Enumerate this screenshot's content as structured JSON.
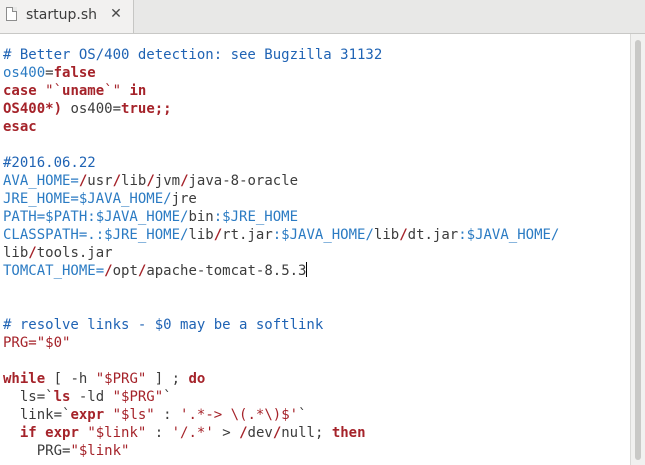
{
  "tab": {
    "filename": "startup.sh",
    "close_glyph": "✕"
  },
  "code": {
    "l1": "# Better OS/400 detection: see Bugzilla 31132",
    "l2": [
      "os400",
      "=",
      "false"
    ],
    "l3": [
      "case",
      " \"`",
      "uname",
      "`\" ",
      "in"
    ],
    "l4": [
      "OS400*)",
      " os400=",
      "true",
      ";;"
    ],
    "l5": "esac",
    "l7": "#2016.06.22",
    "l8": [
      "AVA_HOME=",
      "/",
      "usr",
      "/",
      "lib",
      "/",
      "jvm",
      "/",
      "java-8-oracle"
    ],
    "l9": [
      "JRE_HOME=$JAVA_HOME/",
      "jre"
    ],
    "l10": [
      "PATH=$PATH:$JAVA_HOME/",
      "bin",
      ":$JRE_HOME"
    ],
    "l11": [
      "CLASSPATH=.:$JRE_HOME/",
      "lib",
      "/",
      "rt.jar",
      ":$JAVA_HOME/",
      "lib",
      "/",
      "dt.jar",
      ":$JAVA_HOME/"
    ],
    "l12": [
      "lib",
      "/",
      "tools.jar"
    ],
    "l13": [
      "TOMCAT_HOME=",
      "/",
      "opt",
      "/",
      "apache-tomcat-8.5.3"
    ],
    "l16": "# resolve links - $0 may be a softlink",
    "l17": "PRG=\"$0\"",
    "l19": [
      "while",
      " [ -h ",
      "\"$PRG\"",
      " ] ; ",
      "do"
    ],
    "l20": [
      "  ls=`",
      "ls",
      " -ld ",
      "\"$PRG\"",
      "`"
    ],
    "l21": [
      "  link=`",
      "expr",
      " ",
      "\"$ls\"",
      " : ",
      "'.*-> \\(.*\\)$'",
      "`"
    ],
    "l22": [
      "  ",
      "if",
      " ",
      "expr",
      " ",
      "\"$link\"",
      " : ",
      "'/.*'",
      " > ",
      "/",
      "dev",
      "/",
      "null",
      "; ",
      "then"
    ],
    "l23": [
      "    PRG=",
      "\"$link\""
    ]
  },
  "colors": {
    "comment": "#1f63b4",
    "keyword": "#a5232a",
    "string": "#a5232a",
    "path_slash": "#1f63b4"
  }
}
